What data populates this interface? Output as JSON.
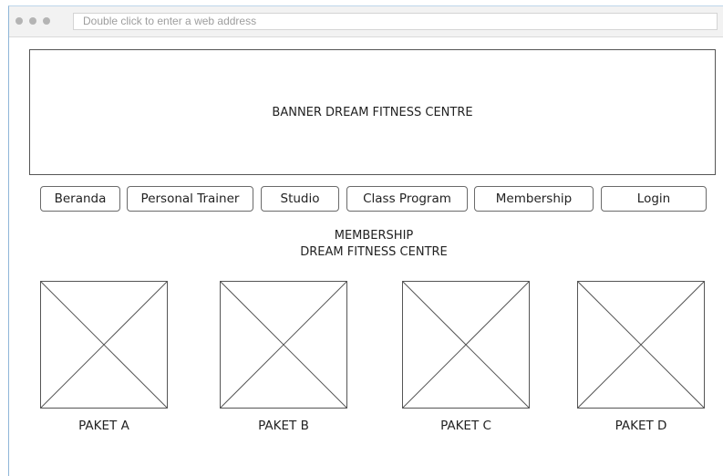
{
  "browser": {
    "address_placeholder": "Double click to enter a web address"
  },
  "banner": {
    "text": "BANNER DREAM FITNESS CENTRE"
  },
  "nav": {
    "items": [
      {
        "label": "Beranda"
      },
      {
        "label": "Personal Trainer"
      },
      {
        "label": "Studio"
      },
      {
        "label": "Class Program"
      },
      {
        "label": "Membership"
      },
      {
        "label": "Login"
      }
    ]
  },
  "main": {
    "heading_line1": "MEMBERSHIP",
    "heading_line2": "DREAM FITNESS CENTRE",
    "pakets": [
      {
        "label": "PAKET A"
      },
      {
        "label": "PAKET B"
      },
      {
        "label": "PAKET C"
      },
      {
        "label": "PAKET D"
      }
    ]
  },
  "colors": {
    "window_border": "#8fb6d8",
    "titlebar": "#f2f2f2",
    "traffic_dot": "#b4b4b4",
    "wire_stroke": "#555555"
  }
}
